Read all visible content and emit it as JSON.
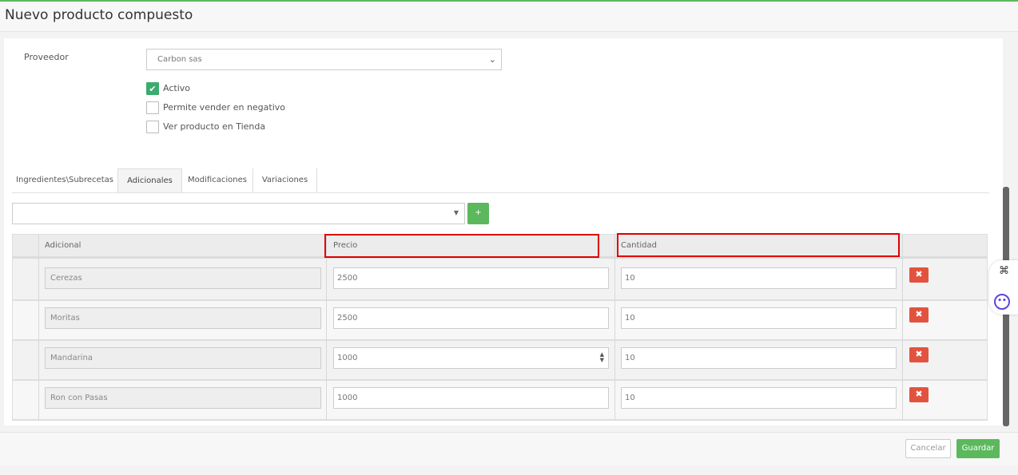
{
  "header": {
    "title": "Nuevo producto compuesto"
  },
  "form": {
    "proveedor_label": "Proveedor",
    "proveedor_value": "Carbon sas",
    "checkboxes": [
      {
        "label": "Activo",
        "checked": true
      },
      {
        "label": "Permite vender en negativo",
        "checked": false
      },
      {
        "label": "Ver producto en Tienda",
        "checked": false
      }
    ]
  },
  "tabs": [
    {
      "label": "Ingredientes\\Subrecetas",
      "active": false
    },
    {
      "label": "Adicionales",
      "active": true
    },
    {
      "label": "Modificaciones",
      "active": false
    },
    {
      "label": "Variaciones",
      "active": false
    }
  ],
  "add_row": {
    "select_value": "",
    "add_button_label": "+"
  },
  "table": {
    "headers": [
      "Adicional",
      "Precio",
      "Cantidad"
    ],
    "rows": [
      {
        "adicional": "Cerezas",
        "precio": "2500",
        "cantidad": "10"
      },
      {
        "adicional": "Moritas",
        "precio": "2500",
        "cantidad": "10"
      },
      {
        "adicional": "Mandarina",
        "precio": "1000",
        "cantidad": "10"
      },
      {
        "adicional": "Ron con Pasas",
        "precio": "1000",
        "cantidad": "10"
      }
    ],
    "delete_icon": "x-icon"
  },
  "footer": {
    "cancel_label": "Cancelar",
    "save_label": "Guardar"
  },
  "colors": {
    "accent_green": "#5cb85c",
    "checkbox_green": "#3bab6e",
    "delete_red": "#e2533f",
    "highlight_red": "#e00000"
  }
}
